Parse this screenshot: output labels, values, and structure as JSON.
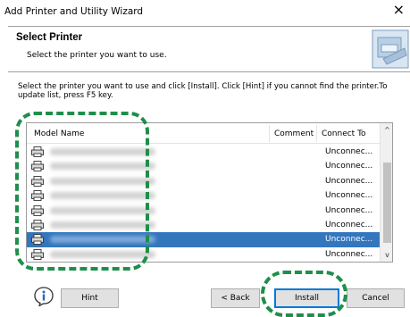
{
  "window": {
    "title": "Add Printer and Utility Wizard",
    "close_glyph": "×"
  },
  "header": {
    "title": "Select Printer",
    "subtitle": "Select the printer you want to use.",
    "icon": "wizard-printer-icon"
  },
  "instructions": "Select the printer you want to use and click [Install]. Click [Hint] if you cannot find the printer.To update list, press F5 key.",
  "printer_list": {
    "columns": [
      "Model Name",
      "Comment",
      "Connect To"
    ],
    "rows": [
      {
        "connect_to": "Unconnec...",
        "selected": false
      },
      {
        "connect_to": "Unconnec...",
        "selected": false
      },
      {
        "connect_to": "Unconnec...",
        "selected": false
      },
      {
        "connect_to": "Unconnec...",
        "selected": false
      },
      {
        "connect_to": "Unconnec...",
        "selected": false
      },
      {
        "connect_to": "Unconnec...",
        "selected": false
      },
      {
        "connect_to": "Unconnec...",
        "selected": true
      },
      {
        "connect_to": "Unconnec...",
        "selected": false
      }
    ],
    "scroll_up_glyph": "^",
    "scroll_down_glyph": "v",
    "selection_color": "#3476bd"
  },
  "buttons": {
    "hint": "Hint",
    "back": "< Back",
    "install": "Install",
    "cancel": "Cancel"
  },
  "highlight_color": "#1e8f4a"
}
